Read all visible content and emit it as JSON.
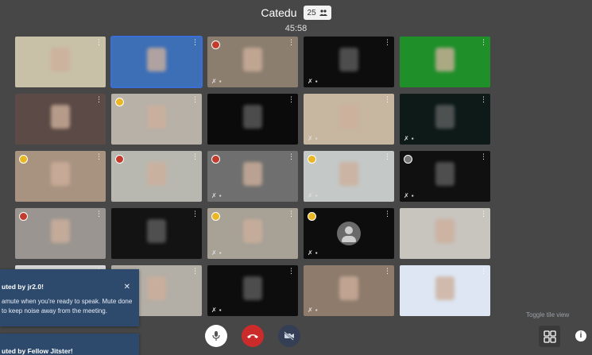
{
  "header": {
    "room_name": "Catedu",
    "participant_count": "25",
    "elapsed_time": "45:58"
  },
  "tiles": [
    {
      "bg": "#c9c0a8",
      "indicator": "none",
      "muted": false
    },
    {
      "bg": "#3d6fb6",
      "indicator": "none",
      "muted": false,
      "active": true
    },
    {
      "bg": "#8c7e6f",
      "indicator": "red",
      "muted": true
    },
    {
      "bg": "#0d0d0d",
      "indicator": "none",
      "muted": true
    },
    {
      "bg": "#1f8f2a",
      "indicator": "none",
      "muted": false
    },
    {
      "bg": "#5b4a45",
      "indicator": "none",
      "muted": false
    },
    {
      "bg": "#b7b1a8",
      "indicator": "yellow",
      "muted": false
    },
    {
      "bg": "#0b0b0b",
      "indicator": "none",
      "muted": false
    },
    {
      "bg": "#c7b7a0",
      "indicator": "none",
      "muted": true
    },
    {
      "bg": "#0d1a18",
      "indicator": "none",
      "muted": true
    },
    {
      "bg": "#a89380",
      "indicator": "yellow",
      "muted": false
    },
    {
      "bg": "#b8b8b0",
      "indicator": "red",
      "muted": false
    },
    {
      "bg": "#6f6f6f",
      "indicator": "red",
      "muted": true
    },
    {
      "bg": "#c4c8c6",
      "indicator": "yellow",
      "muted": true
    },
    {
      "bg": "#101010",
      "indicator": "gray",
      "muted": true
    },
    {
      "bg": "#9a9590",
      "indicator": "red",
      "muted": false
    },
    {
      "bg": "#131313",
      "indicator": "none",
      "muted": false
    },
    {
      "bg": "#a7a196",
      "indicator": "yellow",
      "muted": true
    },
    {
      "bg": "#0d0d0d",
      "indicator": "yellow",
      "muted": true,
      "avatar": true
    },
    {
      "bg": "#c8c4be",
      "indicator": "none",
      "muted": false
    },
    {
      "bg": "#d8d8d8",
      "indicator": "none",
      "muted": false
    },
    {
      "bg": "#b3aea6",
      "indicator": "none",
      "muted": false
    },
    {
      "bg": "#0d0d0d",
      "indicator": "none",
      "muted": true
    },
    {
      "bg": "#8e7b6c",
      "indicator": "none",
      "muted": true
    },
    {
      "bg": "#dde6f2",
      "indicator": "none",
      "muted": false
    }
  ],
  "notifications": [
    {
      "title": "uted by jr2.0!",
      "body": "amute when you're ready to speak. Mute done to keep noise away from the meeting."
    },
    {
      "title": "uted by Fellow Jitster!"
    }
  ],
  "toolbar": {
    "tooltip": "Toggle tile view",
    "info_label": "i"
  },
  "colors": {
    "background": "#474747",
    "hangup": "#cb2b2b",
    "accent": "#3a6fd8",
    "notification": "#2d4a6d"
  }
}
